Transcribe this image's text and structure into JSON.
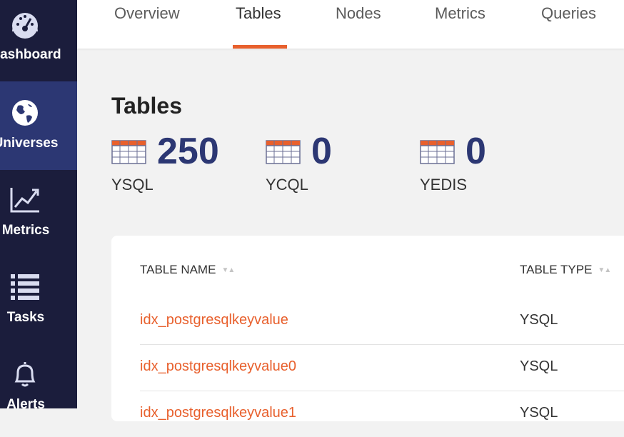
{
  "sidebar": {
    "items": [
      {
        "label": "Dashboard",
        "icon": "gauge-icon"
      },
      {
        "label": "Universes",
        "icon": "globe-icon"
      },
      {
        "label": "Metrics",
        "icon": "line-chart-icon"
      },
      {
        "label": "Tasks",
        "icon": "list-icon"
      },
      {
        "label": "Alerts",
        "icon": "bell-icon"
      }
    ],
    "active": "Universes"
  },
  "tabs": [
    {
      "label": "Overview"
    },
    {
      "label": "Tables"
    },
    {
      "label": "Nodes"
    },
    {
      "label": "Metrics"
    },
    {
      "label": "Queries"
    }
  ],
  "active_tab": "Tables",
  "page": {
    "title": "Tables"
  },
  "stats": [
    {
      "value": "250",
      "label": "YSQL",
      "icon": "table-icon"
    },
    {
      "value": "0",
      "label": "YCQL",
      "icon": "table-icon"
    },
    {
      "value": "0",
      "label": "YEDIS",
      "icon": "table-icon"
    }
  ],
  "table": {
    "columns": [
      "TABLE NAME",
      "TABLE TYPE"
    ],
    "rows": [
      {
        "name": "idx_postgresqlkeyvalue",
        "type": "YSQL"
      },
      {
        "name": "idx_postgresqlkeyvalue0",
        "type": "YSQL"
      },
      {
        "name": "idx_postgresqlkeyvalue1",
        "type": "YSQL"
      }
    ]
  },
  "colors": {
    "sidebar_bg": "#1b1d3c",
    "sidebar_active": "#2c3773",
    "accent": "#e8602d",
    "stat_value": "#2c3773"
  }
}
